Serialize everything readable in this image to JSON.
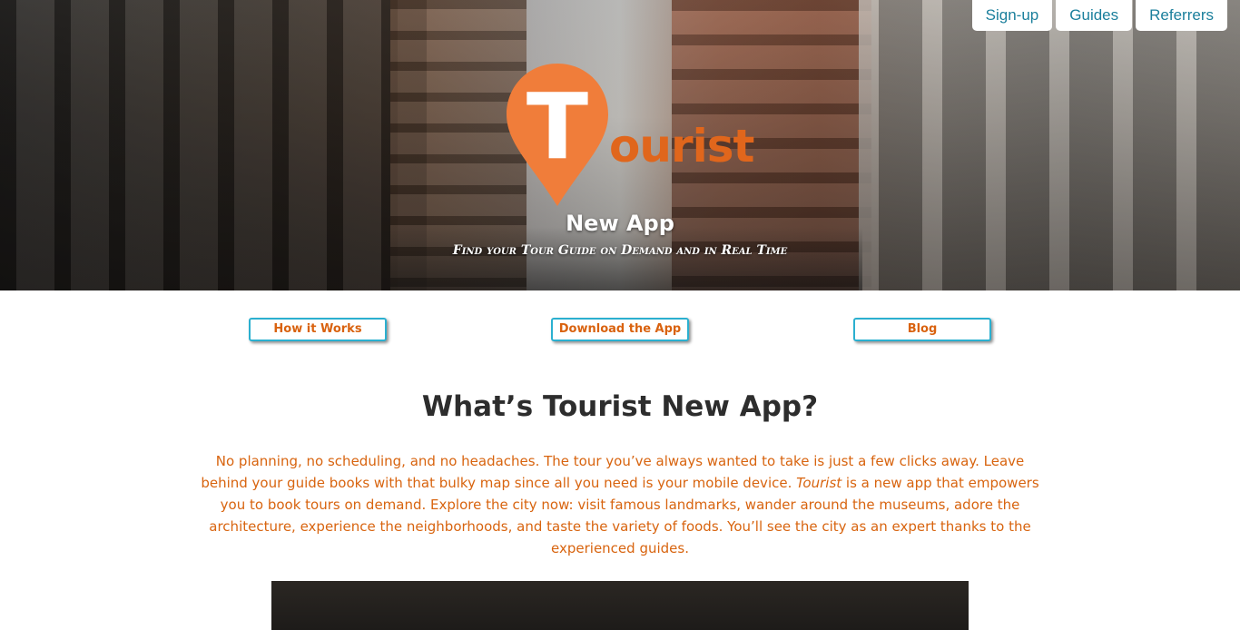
{
  "top_nav": {
    "items": [
      {
        "label": "Sign-up"
      },
      {
        "label": "Guides"
      },
      {
        "label": "Referrers"
      }
    ]
  },
  "hero": {
    "logo": {
      "letter": "T",
      "wordmark": "ourist",
      "icon": "map-pin-icon",
      "color": "#f07d3a"
    },
    "title": "New App",
    "subtitle": "Find your Tour Guide on Demand and in Real Time"
  },
  "sub_nav": {
    "items": [
      {
        "label": "How it Works"
      },
      {
        "label": "Download the App"
      },
      {
        "label": "Blog"
      }
    ]
  },
  "section": {
    "title": "What’s Tourist New App?",
    "intro_part1": "No planning, no scheduling, and no headaches. The tour you’ve always wanted to take is just a few clicks away. Leave behind your guide books with that bulky map since all you need is your mobile device. ",
    "intro_em": "Tourist",
    "intro_part2": " is a new app that empowers you to book tours on demand. Explore the city now: visit famous landmarks, wander around the museums, adore the architecture, experience the neighborhoods, and taste the variety of foods. You’ll see the city as an expert thanks to the experienced guides."
  },
  "colors": {
    "accent_orange": "#d8640f",
    "accent_blue": "#2bb0d0",
    "nav_text": "#1b7f9c"
  }
}
